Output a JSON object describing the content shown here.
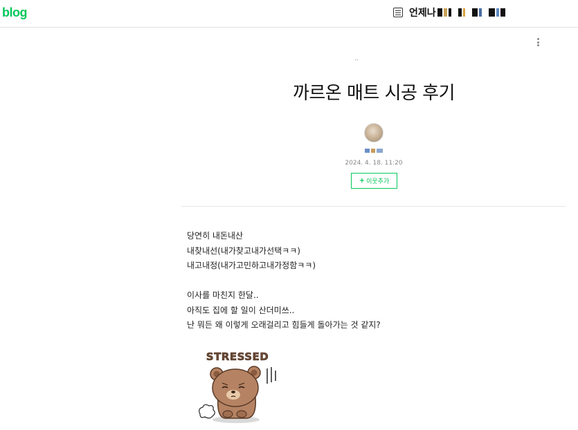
{
  "header": {
    "logo": "blog",
    "blog_title": "언제나",
    "menu_icon": "list-icon"
  },
  "post": {
    "category": "..",
    "title": "까르온 매트 시공 후기",
    "date": "2024. 4. 18. 11:20",
    "neighbor_button": "이웃추가",
    "more_icon": "more-vertical-icon"
  },
  "body": {
    "lines": [
      "당연히 내돈내산",
      "내찾내선(내가찾고내가선택ㅋㅋ)",
      "내고내정(내가고민하고내가정함ㅋㅋ)",
      "",
      "이사를 마친지 한달..",
      "아직도 집에 할 일이 산더미쓰..",
      "난 뭐든 왜 이렇게 오래걸리고 힘들게 돌아가는 것 같지?"
    ]
  },
  "sticker": {
    "caption": "STRESSED",
    "icon": "stressed-bear-sticker"
  },
  "colors": {
    "accent": "#03c75a",
    "text": "#222222",
    "muted": "#888888",
    "border": "#e2e2e2"
  }
}
